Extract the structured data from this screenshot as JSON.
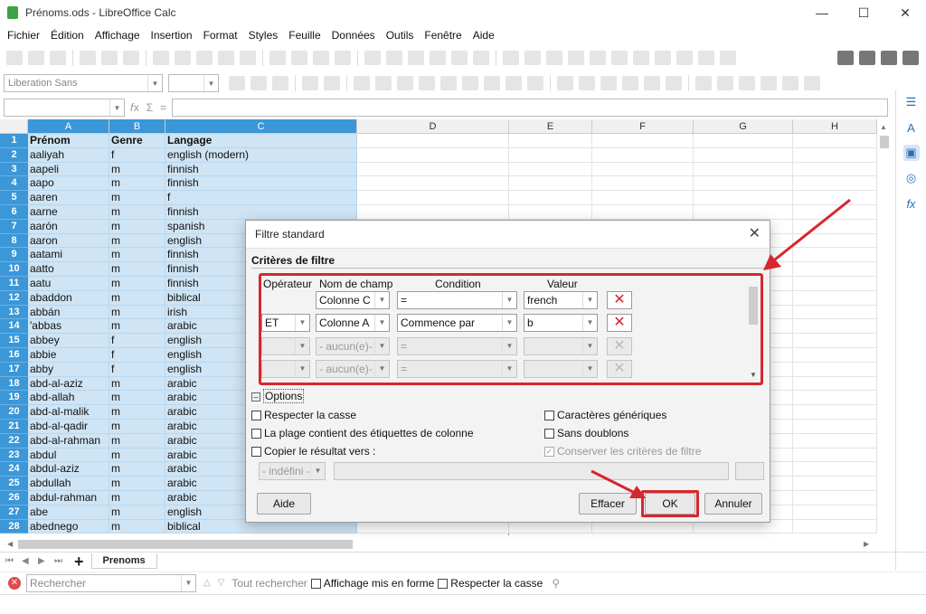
{
  "window": {
    "title": "Prénoms.ods - LibreOffice Calc",
    "min": "—",
    "max": "☐",
    "close": "✕"
  },
  "menu": [
    "Fichier",
    "Édition",
    "Affichage",
    "Insertion",
    "Format",
    "Styles",
    "Feuille",
    "Données",
    "Outils",
    "Fenêtre",
    "Aide"
  ],
  "font": {
    "name": "Liberation Sans"
  },
  "columns": [
    "A",
    "B",
    "C",
    "D",
    "E",
    "F",
    "G",
    "H"
  ],
  "rows": [
    [
      "1",
      "Prénom",
      "Genre",
      "Langage"
    ],
    [
      "2",
      "aaliyah",
      "f",
      "english (modern)"
    ],
    [
      "3",
      "aapeli",
      "m",
      "finnish"
    ],
    [
      "4",
      "aapo",
      "m",
      "finnish"
    ],
    [
      "5",
      "aaren",
      "m",
      "f"
    ],
    [
      "6",
      "aarne",
      "m",
      "finnish"
    ],
    [
      "7",
      "aarón",
      "m",
      "spanish"
    ],
    [
      "8",
      "aaron",
      "m",
      "english"
    ],
    [
      "9",
      "aatami",
      "m",
      "finnish"
    ],
    [
      "10",
      "aatto",
      "m",
      "finnish"
    ],
    [
      "11",
      "aatu",
      "m",
      "finnish"
    ],
    [
      "12",
      "abaddon",
      "m",
      "biblical"
    ],
    [
      "13",
      "abbán",
      "m",
      "irish"
    ],
    [
      "14",
      "'abbas",
      "m",
      "arabic"
    ],
    [
      "15",
      "abbey",
      "f",
      "english"
    ],
    [
      "16",
      "abbie",
      "f",
      "english"
    ],
    [
      "17",
      "abby",
      "f",
      "english"
    ],
    [
      "18",
      "abd-al-aziz",
      "m",
      "arabic"
    ],
    [
      "19",
      "abd-allah",
      "m",
      "arabic"
    ],
    [
      "20",
      "abd-al-malik",
      "m",
      "arabic"
    ],
    [
      "21",
      "abd-al-qadir",
      "m",
      "arabic"
    ],
    [
      "22",
      "abd-al-rahman",
      "m",
      "arabic"
    ],
    [
      "23",
      "abdul",
      "m",
      "arabic"
    ],
    [
      "24",
      "abdul-aziz",
      "m",
      "arabic"
    ],
    [
      "25",
      "abdullah",
      "m",
      "arabic"
    ],
    [
      "26",
      "abdul-rahman",
      "m",
      "arabic"
    ],
    [
      "27",
      "abe",
      "m",
      "english"
    ],
    [
      "28",
      "abednego",
      "m",
      "biblical"
    ]
  ],
  "sheet": {
    "add": "+",
    "tab": "Prenoms"
  },
  "find": {
    "placeholder": "Rechercher",
    "find_all": "Tout rechercher",
    "formatted": "Affichage mis en forme",
    "match_case": "Respecter la casse"
  },
  "dialog": {
    "title": "Filtre standard",
    "close": "✕",
    "section": "Critères de filtre",
    "headers": {
      "op": "Opérateur",
      "field": "Nom de champ",
      "cond": "Condition",
      "value": "Valeur"
    },
    "criteria": [
      {
        "op": "",
        "field": "Colonne C",
        "cond": "=",
        "value": "french"
      },
      {
        "op": "ET",
        "field": "Colonne A",
        "cond": "Commence par",
        "value": "b"
      },
      {
        "op": "",
        "field": "- aucun(e)-",
        "cond": "=",
        "value": ""
      },
      {
        "op": "",
        "field": "- aucun(e)-",
        "cond": "=",
        "value": ""
      }
    ],
    "options_label": "Options",
    "opt_case": "Respecter la casse",
    "opt_labels": "La plage contient des étiquettes de colonne",
    "opt_copy": "Copier le résultat vers :",
    "opt_wildcards": "Caractères génériques",
    "opt_nodup": "Sans doublons",
    "opt_keep": "Conserver les critères de filtre",
    "copy_target": "- indéfini -",
    "btn_help": "Aide",
    "btn_clear": "Effacer",
    "btn_ok": "OK",
    "btn_cancel": "Annuler"
  },
  "colors": {
    "selection": "#cfe4f4",
    "header_sel": "#3b97d8",
    "highlight": "#d6272e"
  }
}
